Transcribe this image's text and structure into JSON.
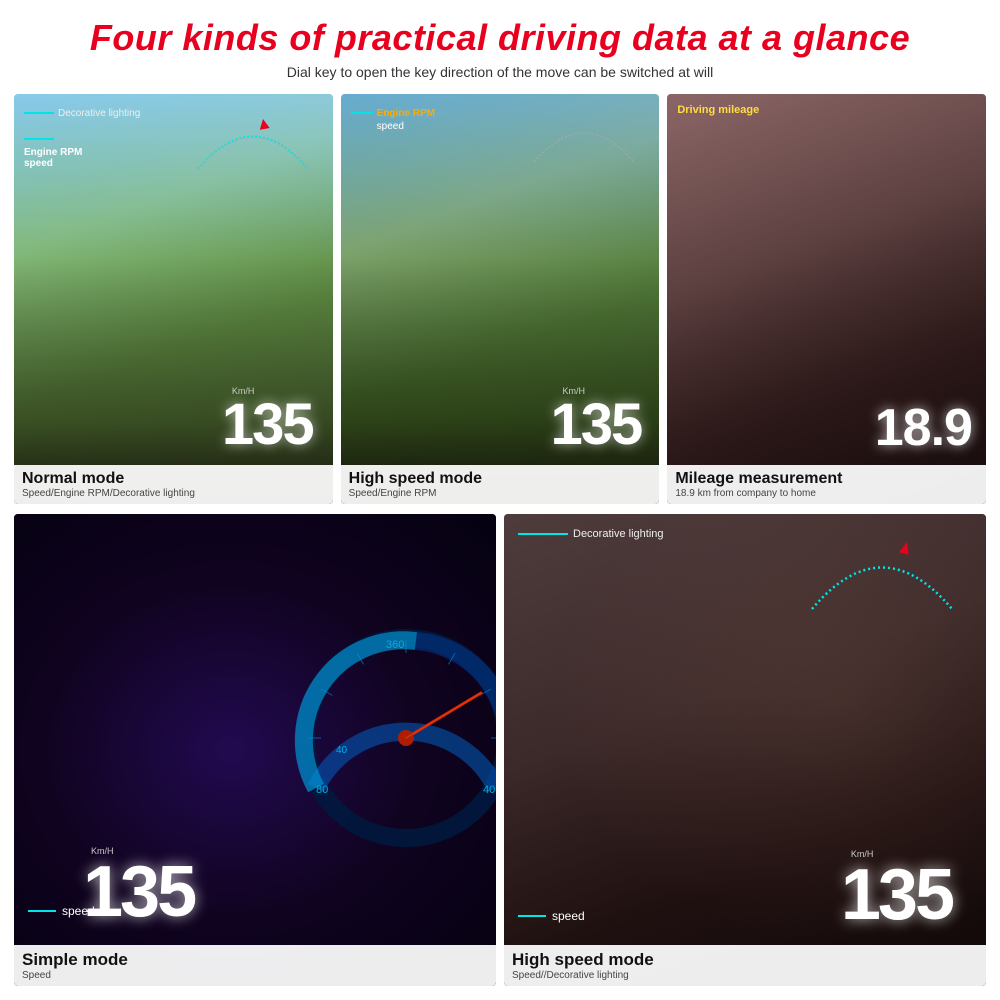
{
  "header": {
    "title": "Four kinds of practical driving data at a glance",
    "subtitle": "Dial key to open the key direction of the move can be switched at will"
  },
  "cards": {
    "normal": {
      "decorative_label": "Decorative lighting",
      "engine_label": "Engine RPM\nspeed",
      "kmh": "Km/H",
      "speed": "135",
      "mode_title": "Normal mode",
      "mode_subtitle": "Speed/Engine RPM/Decorative lighting"
    },
    "high_speed": {
      "engine_label": "Engine RPM\nspeed",
      "kmh": "Km/H",
      "speed": "135",
      "mode_title": "High speed mode",
      "mode_subtitle": "Speed/Engine RPM"
    },
    "mileage": {
      "driving_label": "Driving mileage",
      "speed": "18.9",
      "mode_title": "Mileage measurement",
      "mode_subtitle": "18.9 km from company to home"
    },
    "simple": {
      "speed_label": "speed",
      "kmh": "Km/H",
      "speed": "135",
      "mode_title": "Simple mode",
      "mode_subtitle": "Speed"
    },
    "hsd": {
      "decorative_label": "Decorative lighting",
      "speed_label": "speed",
      "kmh": "Km/H",
      "speed": "135",
      "mode_title": "High speed mode",
      "mode_subtitle": "Speed//Decorative lighting"
    }
  }
}
